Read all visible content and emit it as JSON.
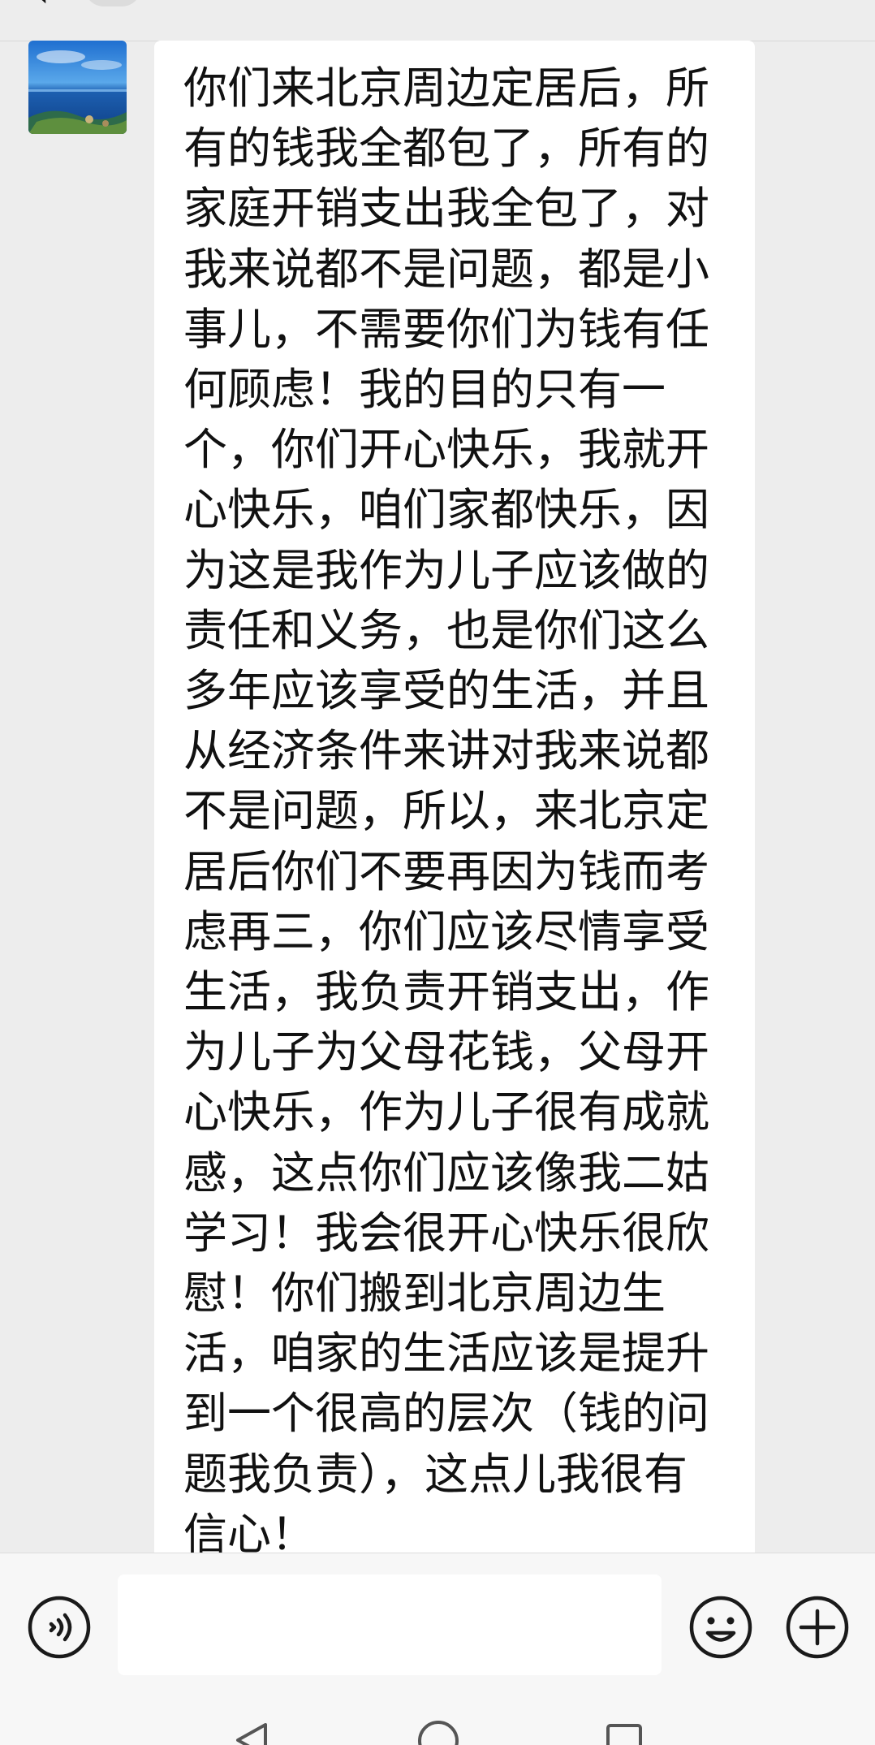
{
  "header": {
    "back_icon": "chevron-left-icon",
    "title": "",
    "accent_color": "#ededed"
  },
  "chat": {
    "messages": [
      {
        "sender_avatar": "ocean-avatar",
        "text": "你们来北京周边定居后，所有的钱我全都包了，所有的家庭开销支出我全包了，对我来说都不是问题，都是小事儿，不需要你们为钱有任何顾虑！我的目的只有一个，你们开心快乐，我就开心快乐，咱们家都快乐，因为这是我作为儿子应该做的责任和义务，也是你们这么多年应该享受的生活，并且从经济条件来讲对我来说都不是问题，所以，来北京定居后你们不要再因为钱而考虑再三，你们应该尽情享受生活，我负责开销支出，作为儿子为父母花钱，父母开心快乐，作为儿子很有成就感，这点你们应该像我二姑学习！我会很开心快乐很欣慰！你们搬到北京周边生活，咱家的生活应该是提升到一个很高的层次（钱的问题我负责），这点儿我很有信心！"
      }
    ]
  },
  "input_bar": {
    "voice_icon": "voice-icon",
    "input_value": "",
    "emoji_icon": "emoji-icon",
    "plus_icon": "plus-icon"
  },
  "nav_bar": {
    "back_icon": "nav-back-icon",
    "home_icon": "nav-home-icon",
    "recent_icon": "nav-recent-icon"
  }
}
